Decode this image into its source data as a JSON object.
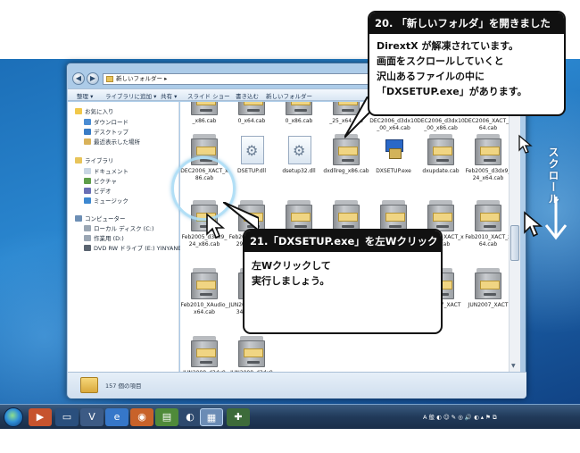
{
  "window": {
    "address": "新しいフォルダー ▸",
    "toolbar": [
      "整理 ▾",
      "ライブラリに追加 ▾",
      "共有 ▾",
      "スライド ショー",
      "書き込む",
      "新しいフォルダー"
    ],
    "status": "157 個の項目"
  },
  "nav_pane": {
    "favorites": "お気に入り",
    "favorites_items": [
      "ダウンロード",
      "デスクトップ",
      "最近表示した場所"
    ],
    "libraries": "ライブラリ",
    "libraries_items": [
      "ドキュメント",
      "ピクチャ",
      "ビデオ",
      "ミュージック"
    ],
    "computer": "コンピューター",
    "computer_items": [
      "ローカル ディスク (C:)",
      "作業用 (D:)",
      "DVD RW ドライブ (E:) YINYANEX"
    ]
  },
  "files": [
    {
      "name": "_x86.cab",
      "type": "cab"
    },
    {
      "name": "0_x64.cab",
      "type": "cab"
    },
    {
      "name": "0_x86.cab",
      "type": "cab"
    },
    {
      "name": "_25_x64.cab",
      "type": "cab"
    },
    {
      "name": "DEC2006_d3dx10_00_x64.cab",
      "type": "cab"
    },
    {
      "name": "DEC2006_d3dx10_00_x86.cab",
      "type": "cab"
    },
    {
      "name": "DEC2006_XACT_x64.cab",
      "type": "cab"
    },
    {
      "name": "DEC2006_XACT_x86.cab",
      "type": "cab"
    },
    {
      "name": "DSETUP.dll",
      "type": "dll"
    },
    {
      "name": "dsetup32.dll",
      "type": "dll"
    },
    {
      "name": "dxdllreg_x86.cab",
      "type": "cab"
    },
    {
      "name": "DXSETUP.exe",
      "type": "exe"
    },
    {
      "name": "dxupdate.cab",
      "type": "cab"
    },
    {
      "name": "Feb2005_d3dx9_24_x64.cab",
      "type": "cab"
    },
    {
      "name": "Feb2005_d3dx9_24_x86.cab",
      "type": "cab"
    },
    {
      "name": "Feb2006_d3dx9_29_x64.cab",
      "type": "cab"
    },
    {
      "name": "Feb2006_d3dx9_29_x86.cab",
      "type": "cab"
    },
    {
      "name": "Feb2006_XACT_x64.cab",
      "type": "cab"
    },
    {
      "name": "Feb2006_XACT_x86.cab",
      "type": "cab"
    },
    {
      "name": "Feb2010_XACT_x86.cab",
      "type": "cab"
    },
    {
      "name": "Feb2010_XACT_x64.cab",
      "type": "cab"
    },
    {
      "name": "Feb2010_XAudio_x64.cab",
      "type": "cab"
    },
    {
      "name": "JUN2007_d3dx9_34_x64.cab",
      "type": "cab"
    },
    {
      "name": "JUN2007_d3dx9",
      "type": "cab"
    },
    {
      "name": "JUN2007_d3dx1",
      "type": "cab"
    },
    {
      "name": "JUN2007_d3dx1",
      "type": "cab"
    },
    {
      "name": "JUN2007_XACT",
      "type": "cab"
    },
    {
      "name": "JUN2007_XACT",
      "type": "cab"
    },
    {
      "name": "JUN2008_d3dx9",
      "type": "cab"
    },
    {
      "name": "JUN2008_d3dx9",
      "type": "cab"
    }
  ],
  "callout_top": {
    "heading": "20. 「新しいフォルダ」を開きました",
    "lines": [
      "DirextX が解凍されています。",
      "画面をスクロールしていくと",
      "沢山あるファイルの中に",
      "「DXSETUP.exe」があります。"
    ]
  },
  "callout_mid": {
    "heading": "21.「DXSETUP.exe」を左Wクリック",
    "lines": [
      "左Wクリックして",
      "実行しましょう。"
    ]
  },
  "scroll_label": "スクロール",
  "taskbar": {
    "tray": "A 般 ◐ ☺ ✎ ◎ 🔊 ◐ ▴ ⚑ ⧉"
  }
}
